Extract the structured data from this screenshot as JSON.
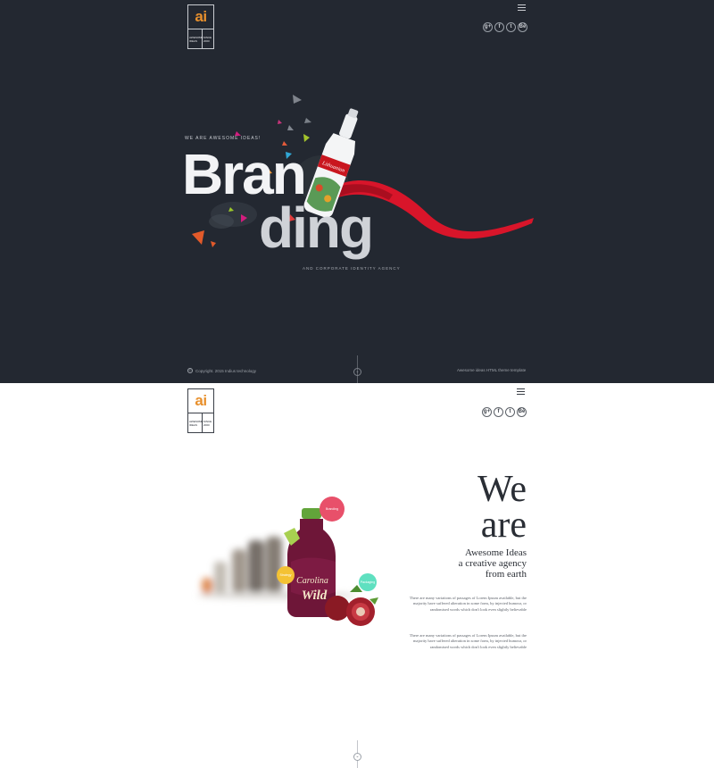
{
  "hero": {
    "logo": {
      "mark": "ai",
      "text_left": "AWESOME IDEAS",
      "text_right": "SINCE 2000"
    },
    "socials": [
      {
        "icon": "google-plus-icon",
        "glyph": "g+"
      },
      {
        "icon": "facebook-icon",
        "glyph": "f"
      },
      {
        "icon": "twitter-icon",
        "glyph": "t"
      },
      {
        "icon": "behance-icon",
        "glyph": "Bē"
      }
    ],
    "tagline": "WE ARE AWESOME IDEAS!",
    "title_part1": "Bran",
    "title_part2": "ding",
    "subline": "AND CORPORATE IDENTITY AGENCY",
    "footer_left": "Copyright. 2015 Indius technology",
    "footer_right": "Awesome ideas HTML theme template",
    "copyright_glyph": "©",
    "scroll_glyph": "⌄",
    "colors": {
      "background": "#232831",
      "accent": "#e8902d",
      "ribbon": "#d8152a"
    }
  },
  "about": {
    "logo": {
      "mark": "ai",
      "text_left": "AWESOME IDEAS",
      "text_right": "SINCE 2000"
    },
    "socials": [
      {
        "icon": "google-plus-icon",
        "glyph": "g+"
      },
      {
        "icon": "facebook-icon",
        "glyph": "f"
      },
      {
        "icon": "twitter-icon",
        "glyph": "t"
      },
      {
        "icon": "behance-icon",
        "glyph": "Bē"
      }
    ],
    "we": "We",
    "are": "are",
    "headline_line1": "Awesome Ideas",
    "headline_line2": "a creative agency",
    "headline_line3": "from earth",
    "paragraph_1": "There are many variations of passages of Lorem Ipsum available, but the majority have suffered alteration in some form, by injected humour, or randomised words which don't look even slightly believable",
    "paragraph_2": "There are many variations of passages of Lorem Ipsum available, but the majority have suffered alteration in some form, by injected humour, or randomised words which don't look even slightly believable",
    "bubbles": [
      {
        "label": "Branding",
        "color": "#e8506a"
      },
      {
        "label": "Strategy",
        "color": "#f4c233"
      },
      {
        "label": "Packaging",
        "color": "#5fe0c0"
      }
    ],
    "bottle_label_1": "Carolina",
    "bottle_label_2": "Wild",
    "scroll_glyph": "⌄"
  }
}
